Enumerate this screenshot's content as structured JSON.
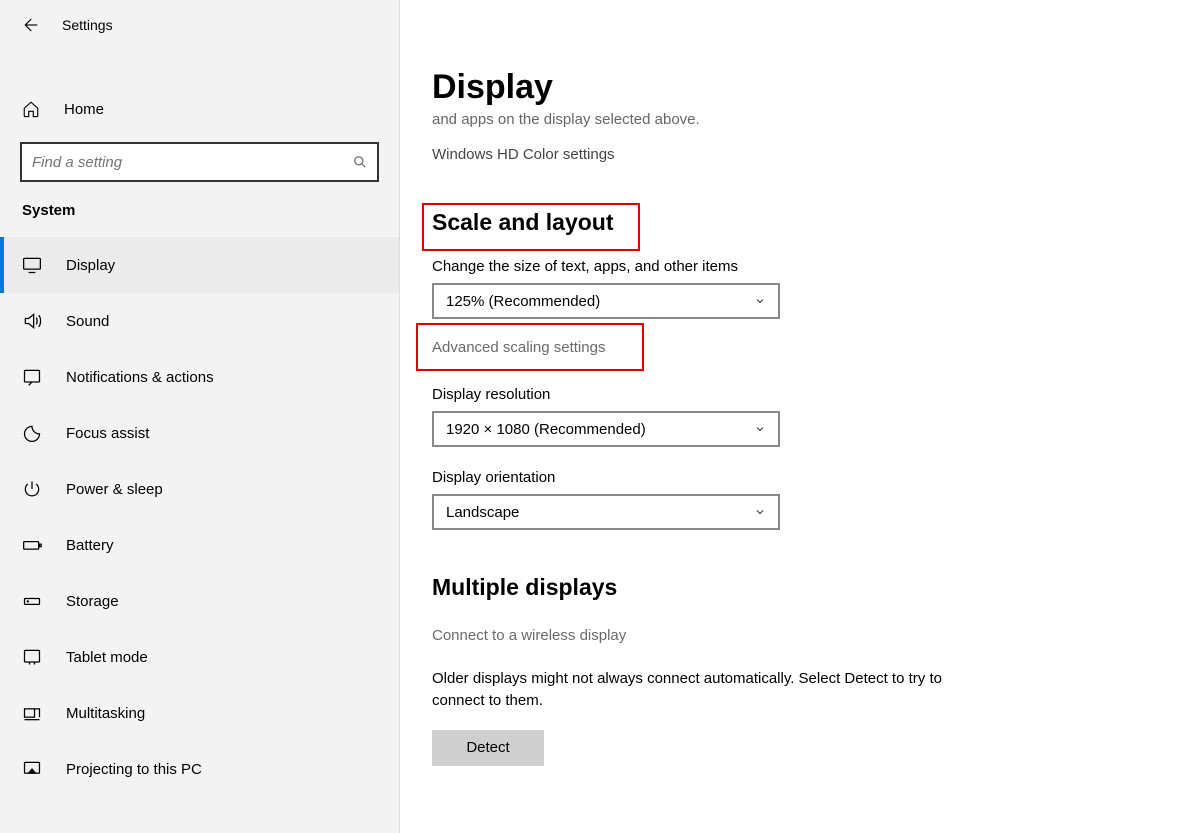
{
  "app": {
    "title": "Settings"
  },
  "sidebar": {
    "home_label": "Home",
    "search_placeholder": "Find a setting",
    "category": "System",
    "items": [
      {
        "label": "Display",
        "icon": "display"
      },
      {
        "label": "Sound",
        "icon": "sound"
      },
      {
        "label": "Notifications & actions",
        "icon": "notifications"
      },
      {
        "label": "Focus assist",
        "icon": "focus"
      },
      {
        "label": "Power & sleep",
        "icon": "power"
      },
      {
        "label": "Battery",
        "icon": "battery"
      },
      {
        "label": "Storage",
        "icon": "storage"
      },
      {
        "label": "Tablet mode",
        "icon": "tablet"
      },
      {
        "label": "Multitasking",
        "icon": "multitask"
      },
      {
        "label": "Projecting to this PC",
        "icon": "project"
      }
    ]
  },
  "main": {
    "page_title": "Display",
    "cropped_line": "and apps on the display selected above.",
    "hd_link": "Windows HD Color settings",
    "scale_heading": "Scale and layout",
    "scale_label": "Change the size of text, apps, and other items",
    "scale_value": "125% (Recommended)",
    "adv_scaling": "Advanced scaling settings",
    "res_label": "Display resolution",
    "res_value": "1920 × 1080 (Recommended)",
    "orient_label": "Display orientation",
    "orient_value": "Landscape",
    "multi_heading": "Multiple displays",
    "wireless_link": "Connect to a wireless display",
    "detect_desc": "Older displays might not always connect automatically. Select Detect to try to connect to them.",
    "detect_btn": "Detect"
  }
}
